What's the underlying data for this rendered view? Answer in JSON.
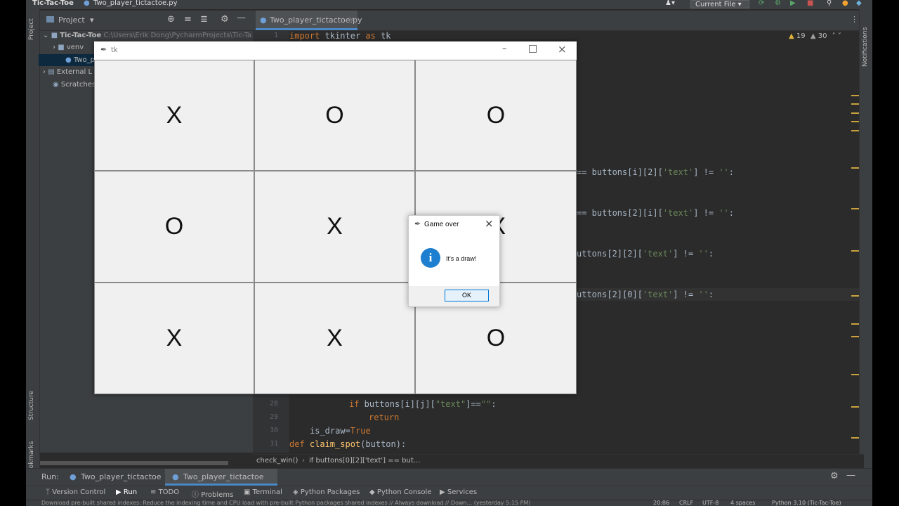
{
  "ide": {
    "project_name": "Tic-Tac-Toe",
    "file_title": "Two_player_tictactoe.py",
    "run_config": "Current File",
    "project_tab": "Project",
    "editor_tab": "Two_player_tictactoe.py",
    "warnings": "19",
    "weak_warnings": "30",
    "notifications_label": "Notifications",
    "structure_label": "Structure",
    "bookmarks_label": "Bookmarks",
    "project_strip_label": "Project",
    "tree": [
      {
        "label": "Tic-Tac-Toe",
        "path": "C:\\Users\\Erik Dong\\PycharmProjects\\Tic-Ta"
      },
      {
        "label": "venv"
      },
      {
        "label": "Two_p"
      },
      {
        "label": "External L"
      },
      {
        "label": "Scratches"
      }
    ],
    "code": {
      "line1_kw": "import",
      "line1_rest": " tkinter ",
      "line1_as": "as",
      "line1_alias": " tk",
      "frag1_a": "== buttons[i][2][",
      "frag1_s": "'text'",
      "frag1_b": "] != ",
      "frag1_e": "''",
      "frag1_c": ":",
      "frag2_a": "== buttons[2][i][",
      "frag2_s": "'text'",
      "frag2_b": "] != ",
      "frag2_e": "''",
      "frag2_c": ":",
      "frag3_a": "uttons[2][2][",
      "frag3_s": "'text'",
      "frag3_b": "] != ",
      "frag3_e": "''",
      "frag3_c": ":",
      "frag4_a": "uttons[2][0][",
      "frag4_s": "'text'",
      "frag4_b": "] != ",
      "frag4_e": "''",
      "frag4_c": ":",
      "l28_kw": "if",
      "l28_a": " buttons[i][j][",
      "l28_s": "\"text\"",
      "l28_b": "]==",
      "l28_e": "\"\"",
      "l28_c": ":",
      "l29_kw": "return",
      "l30_a": "is_draw=",
      "l30_kw": "True",
      "l31_kw": "def",
      "l31_fn": " claim_spot",
      "l31_a": "(button):"
    },
    "line_numbers": [
      "1",
      "28",
      "29",
      "30",
      "31"
    ],
    "breadcrumb_fn": "check_win()",
    "breadcrumb_cond": "if buttons[0][2]['text'] == but...",
    "run_label": "Run:",
    "run_tabs": [
      "Two_player_tictactoe",
      "Two_player_tictactoe"
    ],
    "bottom_tools": [
      "Version Control",
      "Run",
      "TODO",
      "Problems",
      "Terminal",
      "Python Packages",
      "Python Console",
      "Services"
    ],
    "status_msg": "Download pre-built shared indexes: Reduce the indexing time and CPU load with pre-built Python packages shared indexes // Always download // Down... (yesterday 5:15 PM)",
    "status_pos": "20:86",
    "status_crlf": "CRLF",
    "status_enc": "UTF-8",
    "status_indent": "4 spaces",
    "status_interp": "Python 3.10 (Tic-Tac-Toe)"
  },
  "tk_window": {
    "title": "tk",
    "board": [
      "X",
      "O",
      "O",
      "O",
      "X",
      "X",
      "X",
      "X",
      "O"
    ]
  },
  "dialog": {
    "title": "Game over",
    "message": "It's a draw!",
    "ok_label": "OK"
  }
}
